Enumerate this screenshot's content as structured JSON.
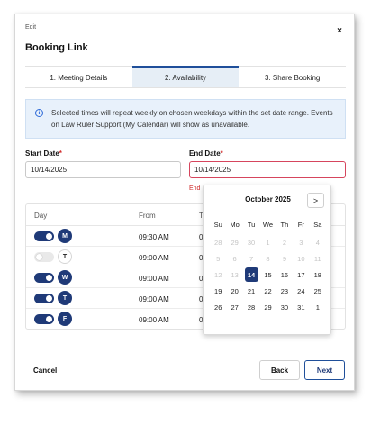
{
  "header": {
    "eyebrow": "Edit",
    "title": "Booking Link",
    "close_glyph": "×"
  },
  "tabs": [
    {
      "label": "1. Meeting Details"
    },
    {
      "label": "2. Availability"
    },
    {
      "label": "3. Share Booking"
    }
  ],
  "info": {
    "text": "Selected times will repeat weekly on chosen weekdays within the set date range. Events on Law Ruler Support (My Calendar) will show as unavailable."
  },
  "start_date": {
    "label": "Start Date",
    "required": "*",
    "value": "10/14/2025"
  },
  "end_date": {
    "label": "End Date",
    "required": "*",
    "value": "10/14/2025",
    "error": "End"
  },
  "table": {
    "headers": {
      "day": "Day",
      "from": "From",
      "to": "T"
    },
    "rows": [
      {
        "on": true,
        "day": "M",
        "from": "09:30 AM",
        "to": "0"
      },
      {
        "on": false,
        "day": "T",
        "from": "09:00 AM",
        "to": "0"
      },
      {
        "on": true,
        "day": "W",
        "from": "09:00 AM",
        "to": "0"
      },
      {
        "on": true,
        "day": "T",
        "from": "09:00 AM",
        "to": "0"
      },
      {
        "on": true,
        "day": "F",
        "from": "09:00 AM",
        "to": "0"
      }
    ]
  },
  "calendar": {
    "month": "October 2025",
    "next_glyph": ">",
    "weekdays": [
      "Su",
      "Mo",
      "Tu",
      "We",
      "Th",
      "Fr",
      "Sa"
    ],
    "days": [
      [
        "28",
        "29",
        "30",
        "1",
        "2",
        "3",
        "4"
      ],
      [
        "5",
        "6",
        "7",
        "8",
        "9",
        "10",
        "11"
      ],
      [
        "12",
        "13",
        "14",
        "15",
        "16",
        "17",
        "18"
      ],
      [
        "19",
        "20",
        "21",
        "22",
        "23",
        "24",
        "25"
      ],
      [
        "26",
        "27",
        "28",
        "29",
        "30",
        "31",
        "1"
      ]
    ],
    "disabled": [
      "0-0",
      "0-1",
      "0-2",
      "0-3",
      "0-4",
      "0-5",
      "0-6",
      "1-0",
      "1-1",
      "1-2",
      "1-3",
      "1-4",
      "1-5",
      "1-6",
      "2-0",
      "2-1"
    ],
    "selected": "2-2"
  },
  "footer": {
    "cancel": "Cancel",
    "back": "Back",
    "next": "Next"
  },
  "colors": {
    "accent": "#1f3a78",
    "error": "#d12b2b",
    "info_bg": "#e8f1fb"
  }
}
